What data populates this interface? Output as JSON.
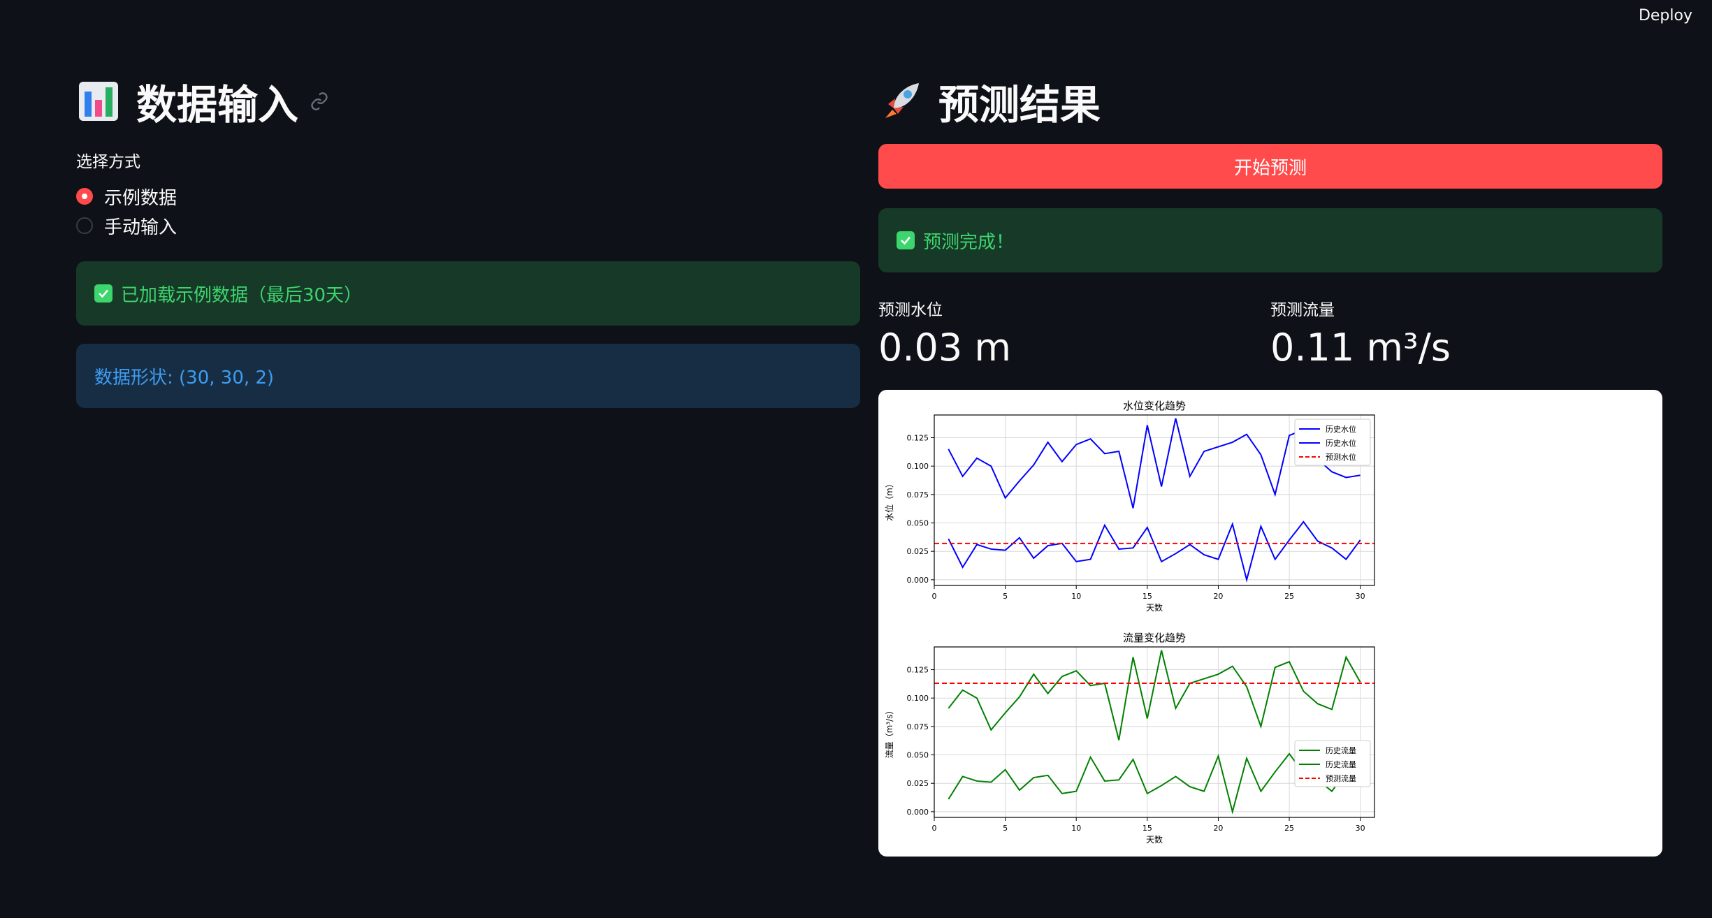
{
  "header": {
    "deploy_label": "Deploy"
  },
  "left": {
    "title": "数据输入",
    "radio": {
      "label": "选择方式",
      "options": [
        {
          "label": "示例数据",
          "selected": true
        },
        {
          "label": "手动输入",
          "selected": false
        }
      ]
    },
    "success_msg": "已加载示例数据（最后30天）",
    "info_msg": "数据形状: (30, 30, 2)"
  },
  "right": {
    "title": "预测结果",
    "predict_button": "开始预测",
    "success_msg": "预测完成！",
    "metrics": [
      {
        "label": "预测水位",
        "value": "0.03 m"
      },
      {
        "label": "预测流量",
        "value": "0.11 m³/s"
      }
    ]
  },
  "colors": {
    "primary": "#ff4b4b",
    "success_bg": "#173928",
    "success_fg": "#3dd56d",
    "info_bg": "#172d43",
    "info_fg": "#3d9df3",
    "bg": "#0e1117"
  },
  "chart_data": [
    {
      "type": "line",
      "title": "水位变化趋势",
      "xlabel": "天数",
      "ylabel": "水位（m）",
      "xlim": [
        0,
        31
      ],
      "ylim": [
        -0.005,
        0.145
      ],
      "xticks": [
        0,
        5,
        10,
        15,
        20,
        25,
        30
      ],
      "yticks": [
        "0.000",
        "0.025",
        "0.050",
        "0.075",
        "0.100",
        "0.125"
      ],
      "grid": true,
      "legend_position": "top-right",
      "x": [
        1,
        2,
        3,
        4,
        5,
        6,
        7,
        8,
        9,
        10,
        11,
        12,
        13,
        14,
        15,
        16,
        17,
        18,
        19,
        20,
        21,
        22,
        23,
        24,
        25,
        26,
        27,
        28,
        29,
        30
      ],
      "series": [
        {
          "name": "历史水位",
          "color": "#0000ff",
          "style": "solid",
          "values": [
            0.115,
            0.091,
            0.107,
            0.1,
            0.072,
            0.087,
            0.101,
            0.121,
            0.104,
            0.119,
            0.124,
            0.111,
            0.113,
            0.063,
            0.136,
            0.082,
            0.142,
            0.091,
            0.113,
            0.117,
            0.121,
            0.128,
            0.11,
            0.075,
            0.127,
            0.132,
            0.106,
            0.095,
            0.09,
            0.092
          ]
        },
        {
          "name": "历史水位",
          "color": "#0000ff",
          "style": "solid",
          "values": [
            0.036,
            0.011,
            0.031,
            0.027,
            0.026,
            0.037,
            0.019,
            0.03,
            0.032,
            0.016,
            0.018,
            0.048,
            0.027,
            0.028,
            0.046,
            0.016,
            0.023,
            0.031,
            0.022,
            0.018,
            0.049,
            0.0,
            0.047,
            0.018,
            0.035,
            0.051,
            0.034,
            0.028,
            0.018,
            0.035
          ]
        },
        {
          "name": "预测水位",
          "color": "#ff0000",
          "style": "dashed",
          "constant": 0.032
        }
      ]
    },
    {
      "type": "line",
      "title": "流量变化趋势",
      "xlabel": "天数",
      "ylabel": "流量（m³/s）",
      "xlim": [
        0,
        31
      ],
      "ylim": [
        -0.005,
        0.145
      ],
      "xticks": [
        0,
        5,
        10,
        15,
        20,
        25,
        30
      ],
      "yticks": [
        "0.000",
        "0.025",
        "0.050",
        "0.075",
        "0.100",
        "0.125"
      ],
      "grid": true,
      "legend_position": "center-right",
      "x": [
        1,
        2,
        3,
        4,
        5,
        6,
        7,
        8,
        9,
        10,
        11,
        12,
        13,
        14,
        15,
        16,
        17,
        18,
        19,
        20,
        21,
        22,
        23,
        24,
        25,
        26,
        27,
        28,
        29,
        30
      ],
      "series": [
        {
          "name": "历史流量",
          "color": "#008000",
          "style": "solid",
          "values": [
            0.091,
            0.107,
            0.1,
            0.072,
            0.087,
            0.101,
            0.121,
            0.104,
            0.119,
            0.124,
            0.111,
            0.113,
            0.063,
            0.136,
            0.082,
            0.142,
            0.091,
            0.113,
            0.117,
            0.121,
            0.128,
            0.11,
            0.075,
            0.127,
            0.132,
            0.106,
            0.095,
            0.09,
            0.136,
            0.114
          ]
        },
        {
          "name": "历史流量",
          "color": "#008000",
          "style": "solid",
          "values": [
            0.011,
            0.031,
            0.027,
            0.026,
            0.037,
            0.019,
            0.03,
            0.032,
            0.016,
            0.018,
            0.048,
            0.027,
            0.028,
            0.046,
            0.016,
            0.023,
            0.031,
            0.022,
            0.018,
            0.049,
            0.0,
            0.047,
            0.018,
            0.035,
            0.051,
            0.034,
            0.028,
            0.018,
            0.035,
            0.036
          ]
        },
        {
          "name": "预测流量",
          "color": "#ff0000",
          "style": "dashed",
          "constant": 0.113
        }
      ]
    }
  ]
}
